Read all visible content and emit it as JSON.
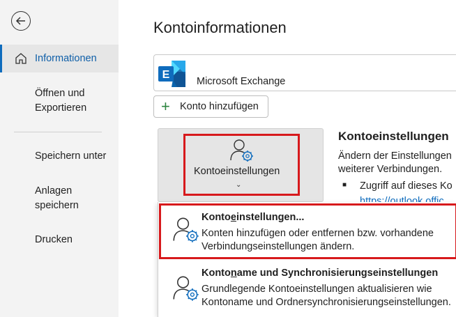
{
  "sidebar": {
    "items": [
      {
        "label": "Informationen"
      },
      {
        "label": "Öffnen und\nExportieren"
      },
      {
        "label": "Speichern unter"
      },
      {
        "label": "Anlagen\nspeichern"
      },
      {
        "label": "Drucken"
      }
    ],
    "back_icon": "back-arrow-icon",
    "home_icon": "home-icon"
  },
  "main": {
    "title": "Kontoinformationen",
    "account_name": "Microsoft Exchange",
    "add_account_label": "Konto hinzufügen",
    "settings_tile_label": "Kontoeinstellungen",
    "section_heading": "Kontoeinstellungen",
    "section_desc_1": "Ändern der Einstellungen",
    "section_desc_2": "weiterer Verbindungen.",
    "bullet_text": "Zugriff auf dieses Ko",
    "partial_link": "https://outlook.offic"
  },
  "dropdown": {
    "items": [
      {
        "title_pre": "Konto",
        "title_u": "e",
        "title_post": "instellungen...",
        "desc_1": "Konten hinzufügen oder entfernen bzw. vorhandene",
        "desc_2": "Verbindungseinstellungen ändern."
      },
      {
        "title_pre": "Konto",
        "title_u": "n",
        "title_post": "ame und Synchronisierungseinstellungen",
        "desc_1": "Grundlegende Kontoeinstellungen aktualisieren wie",
        "desc_2": "Kontoname und Ordnersynchronisierungseinstellungen."
      }
    ]
  },
  "colors": {
    "accent": "#0f6cbd",
    "highlight": "#d7191c",
    "add_icon": "#2e8540"
  }
}
